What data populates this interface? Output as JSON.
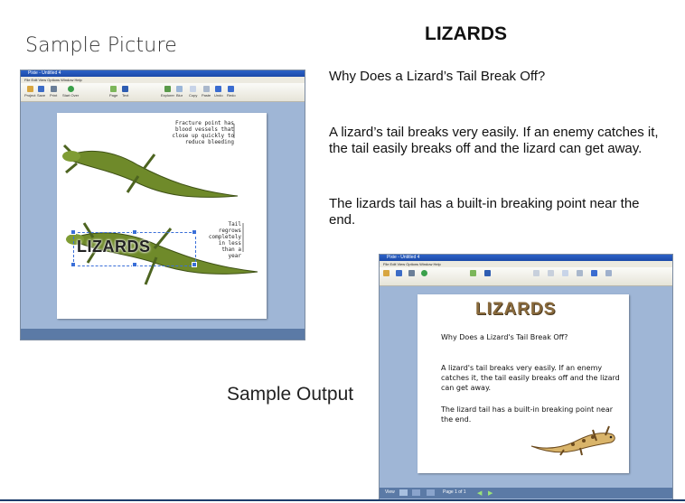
{
  "headings": {
    "sample_picture": "Sample Picture",
    "title": "LIZARDS",
    "sample_output": "Sample Output"
  },
  "content": {
    "question": "Why Does a Lizard’s Tail Break Off?",
    "para1": "A lizard’s tail breaks very easily. If an enemy catches it, the tail easily breaks off and the lizard can get away.",
    "para2": "The lizards tail has a built-in breaking point near the end."
  },
  "screenshot1": {
    "window_title": "Pixie - Untitled 4",
    "menu": "File  Edit  View  Options  Window  Help",
    "toolbar": [
      "Project",
      "Save",
      "Print",
      "Start Over",
      "Page",
      "Text",
      "Explorer",
      "Blur",
      "Copy",
      "Paste",
      "Undo",
      "Redo"
    ],
    "fracture_note": "Fracture point has blood vessels that close up quickly to reduce bleeding",
    "tail_note": "Tail regrows completely in less than a year",
    "label": "LIZARDS"
  },
  "screenshot2": {
    "window_title": "Pixie - Untitled 4",
    "menu": "File  Edit  View  Options  Window  Help",
    "page_title": "LIZARDS",
    "question": "Why Does a Lizard's Tail Break Off?",
    "para1": "A lizard's tail breaks very easily. If an enemy catches it, the tail easily breaks off and the lizard can get away.",
    "para2": "The lizard tail has a built-in breaking point near the end.",
    "status_view": "View",
    "status_page": "Page 1 of 1"
  },
  "colors": {
    "window_bg": "#9fb6d6",
    "titlebar": "#2c62c8",
    "lizard_green": "#6f8a2a",
    "gecko": "#d9b46a"
  }
}
